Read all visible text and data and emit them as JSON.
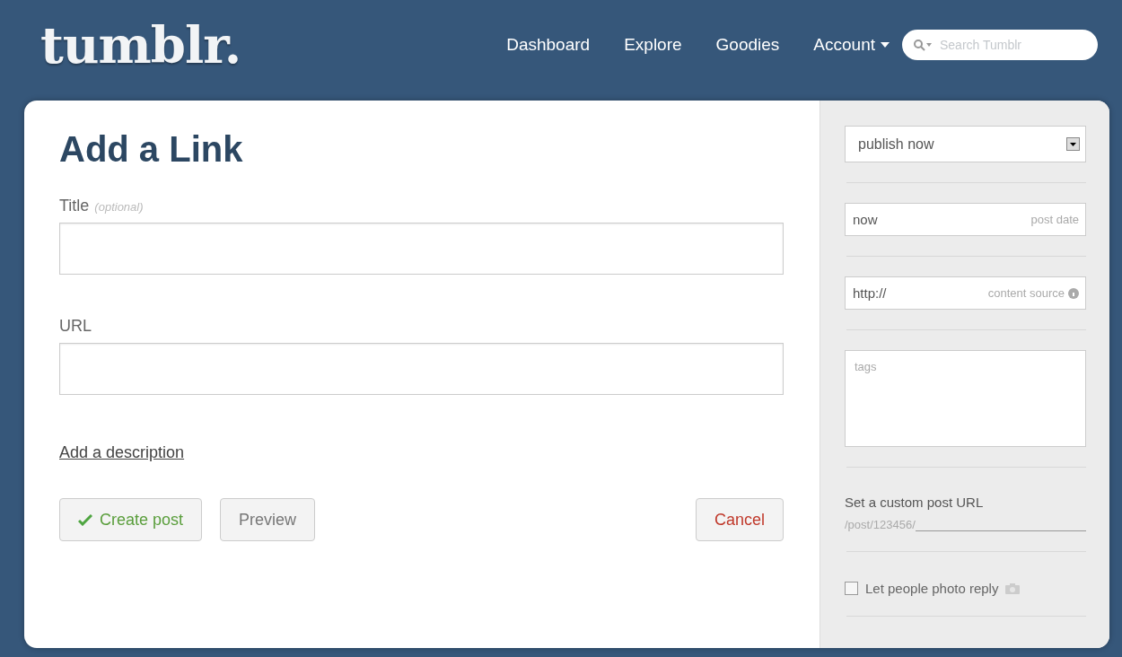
{
  "header": {
    "logo": "tumblr.",
    "nav": [
      {
        "label": "Dashboard",
        "dropdown": false
      },
      {
        "label": "Explore",
        "dropdown": false
      },
      {
        "label": "Goodies",
        "dropdown": false
      },
      {
        "label": "Account",
        "dropdown": true
      }
    ],
    "search": {
      "placeholder": "Search Tumblr"
    }
  },
  "form": {
    "heading": "Add a Link",
    "fields": [
      {
        "label": "Title",
        "hint": "(optional)"
      },
      {
        "label": "URL"
      }
    ],
    "description_link": "Add a description",
    "buttons": [
      {
        "kind": "create",
        "label": "Create post"
      },
      {
        "kind": "preview",
        "label": "Preview"
      },
      {
        "kind": "cancel",
        "label": "Cancel"
      }
    ]
  },
  "sidebar": {
    "publish": {
      "value": "publish now"
    },
    "post_date": {
      "value": "now",
      "hint": "post date"
    },
    "content_source": {
      "value": "http://",
      "hint": "content source"
    },
    "tags": {
      "placeholder": "tags"
    },
    "custom_url": {
      "label": "Set a custom post URL",
      "prefix": "/post/123456/"
    },
    "photo_reply": {
      "label": "Let people photo reply",
      "checked": false
    }
  }
}
